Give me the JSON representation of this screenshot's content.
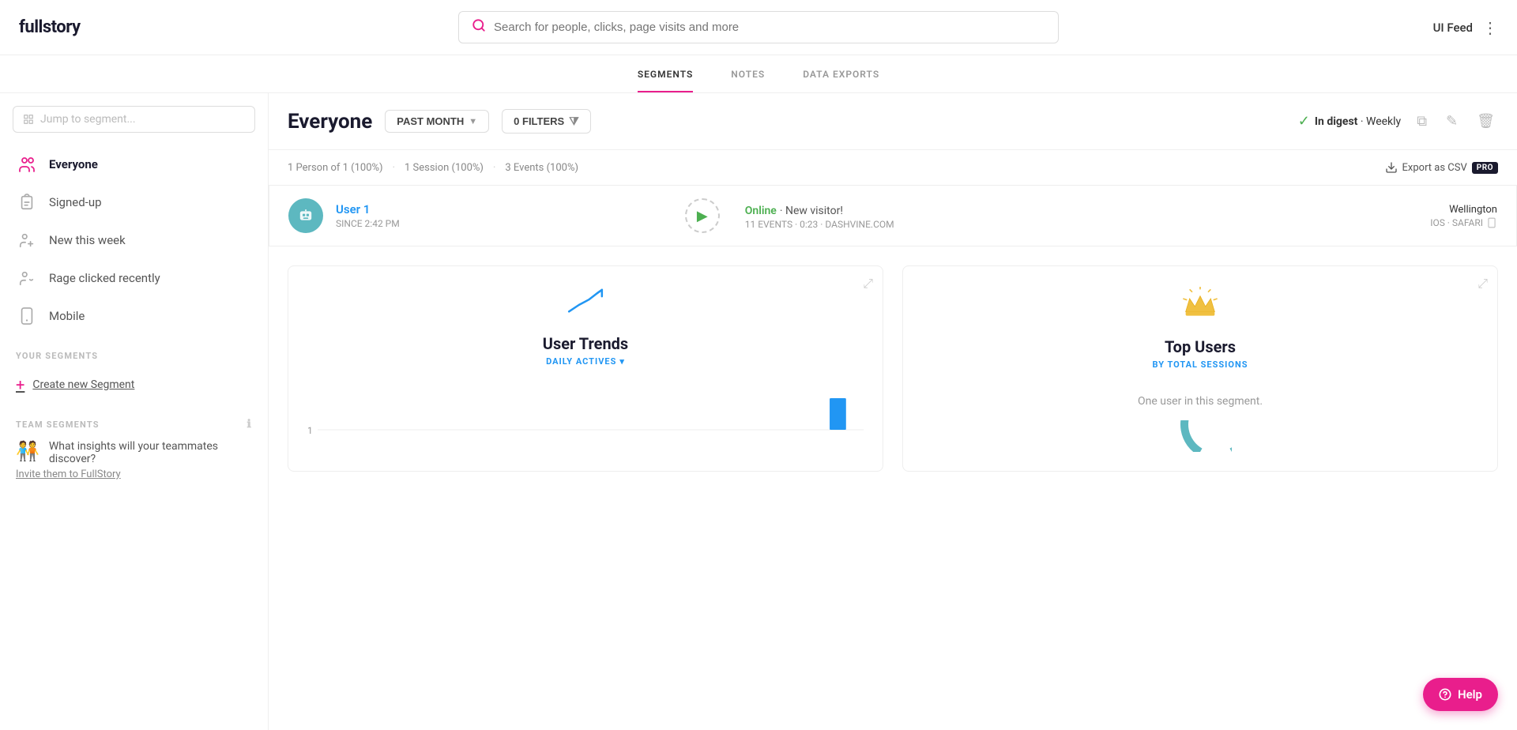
{
  "header": {
    "logo": "fullstory",
    "search_placeholder": "Search for people, clicks, page visits and more",
    "username": "UI Feed",
    "dots": "⋮"
  },
  "nav": {
    "tabs": [
      {
        "id": "segments",
        "label": "SEGMENTS",
        "active": true
      },
      {
        "id": "notes",
        "label": "NOTES",
        "active": false
      },
      {
        "id": "data-exports",
        "label": "DATA EXPORTS",
        "active": false
      }
    ]
  },
  "sidebar": {
    "search_placeholder": "Jump to segment...",
    "items": [
      {
        "id": "everyone",
        "label": "Everyone",
        "icon": "person-group",
        "active": true
      },
      {
        "id": "signed-up",
        "label": "Signed-up",
        "icon": "clipboard",
        "active": false
      },
      {
        "id": "new-this-week",
        "label": "New this week",
        "icon": "person-new",
        "active": false
      },
      {
        "id": "rage-clicked",
        "label": "Rage clicked recently",
        "icon": "person-rage",
        "active": false
      },
      {
        "id": "mobile",
        "label": "Mobile",
        "icon": "mobile",
        "active": false
      }
    ],
    "your_segments_label": "YOUR SEGMENTS",
    "create_segment_label": "Create new Segment",
    "team_segments_label": "TEAM SEGMENTS",
    "team_question": "What insights will your teammates discover?",
    "team_invite": "Invite them to FullStory"
  },
  "content": {
    "title": "Everyone",
    "filters": {
      "date": "PAST MONTH",
      "filters_count": "0 FILTERS"
    },
    "digest": {
      "check": "✓",
      "label": "In digest",
      "period": "Weekly"
    },
    "stats": {
      "persons": "1 Person of 1 (100%)",
      "sessions": "1 Session (100%)",
      "events": "3 Events (100%)"
    },
    "export_label": "Export as CSV",
    "pro_badge": "PRO",
    "user": {
      "name": "User 1",
      "since": "SINCE 2:42 PM",
      "status": "Online",
      "status_note": "New visitor!",
      "events": "11 EVENTS · 0:23 · DASHVINE.COM",
      "location": "Wellington",
      "device": "IOS · SAFARI"
    },
    "cards": [
      {
        "id": "user-trends",
        "icon": "trend",
        "title": "User Trends",
        "subtitle": "DAILY ACTIVES",
        "has_dropdown": true,
        "y_label": "1",
        "chart_data": [
          0,
          0,
          0,
          0,
          0,
          0,
          0,
          0,
          0,
          0,
          0,
          0,
          0,
          0,
          0,
          0,
          0,
          0,
          0,
          0,
          0,
          0,
          0,
          0,
          0,
          0,
          0,
          0,
          1
        ]
      },
      {
        "id": "top-users",
        "icon": "crown",
        "title": "Top Users",
        "subtitle": "BY TOTAL SESSIONS",
        "has_dropdown": false,
        "note": "One user in this segment."
      }
    ]
  },
  "help_btn": "Help"
}
